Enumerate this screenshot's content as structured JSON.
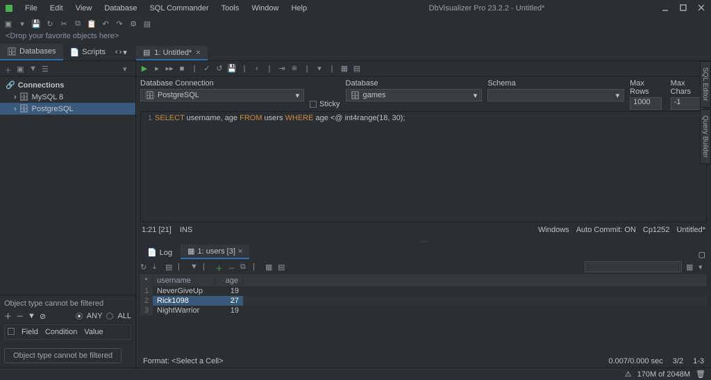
{
  "window": {
    "title": "DbVisualizer Pro 23.2.2 - Untitled*",
    "menu": [
      "File",
      "Edit",
      "View",
      "Database",
      "SQL Commander",
      "Tools",
      "Window",
      "Help"
    ]
  },
  "drop_hint": "<Drop your favorite objects here>",
  "side_tabs": {
    "databases": "Databases",
    "scripts": "Scripts"
  },
  "editor_tab": {
    "label": "1: Untitled*"
  },
  "tree": {
    "header": "Connections",
    "items": [
      {
        "label": "MySQL 8",
        "selected": false
      },
      {
        "label": "PostgreSQL",
        "selected": true
      }
    ]
  },
  "filter": {
    "title": "Object type cannot be filtered",
    "any": "ANY",
    "all": "ALL",
    "field": "Field",
    "condition": "Condition",
    "value": "Value",
    "button": "Object type cannot be filtered"
  },
  "conn": {
    "db_label": "Database Connection",
    "db_value": "PostgreSQL",
    "sticky": "Sticky",
    "database_label": "Database",
    "database_value": "games",
    "schema_label": "Schema",
    "schema_value": "",
    "maxrows_label": "Max Rows",
    "maxrows_value": "1000",
    "maxchars_label": "Max Chars",
    "maxchars_value": "-1"
  },
  "sql": {
    "line_no": "1",
    "select": "SELECT",
    "cols": " username, age ",
    "from": "FROM",
    "tbl": " users ",
    "where": "WHERE",
    "cond": " age <@ int4range(18, 30);"
  },
  "ed_status": {
    "pos": "1:21 [21]",
    "mode": "INS",
    "os": "Windows",
    "ac": "Auto Commit: ON",
    "enc": "Cp1252",
    "file": "Untitled*"
  },
  "result_tabs": {
    "log": "Log",
    "users": "1: users [3]"
  },
  "grid": {
    "headers": {
      "c1": "username",
      "c2": "age"
    },
    "rows": [
      {
        "n": "1",
        "user": "NeverGiveUp",
        "age": "19",
        "sel": false
      },
      {
        "n": "2",
        "user": "Rick1098",
        "age": "27",
        "sel": true
      },
      {
        "n": "3",
        "user": "NightWarrior",
        "age": "19",
        "sel": false
      }
    ]
  },
  "res_status": {
    "format": "Format: <Select a Cell>",
    "time": "0.007/0.000 sec",
    "rows": "3/2",
    "range": "1-3"
  },
  "rails": {
    "sql": "SQL Editor",
    "qb": "Query Builder"
  },
  "footer": {
    "memory": "170M of 2048M"
  }
}
